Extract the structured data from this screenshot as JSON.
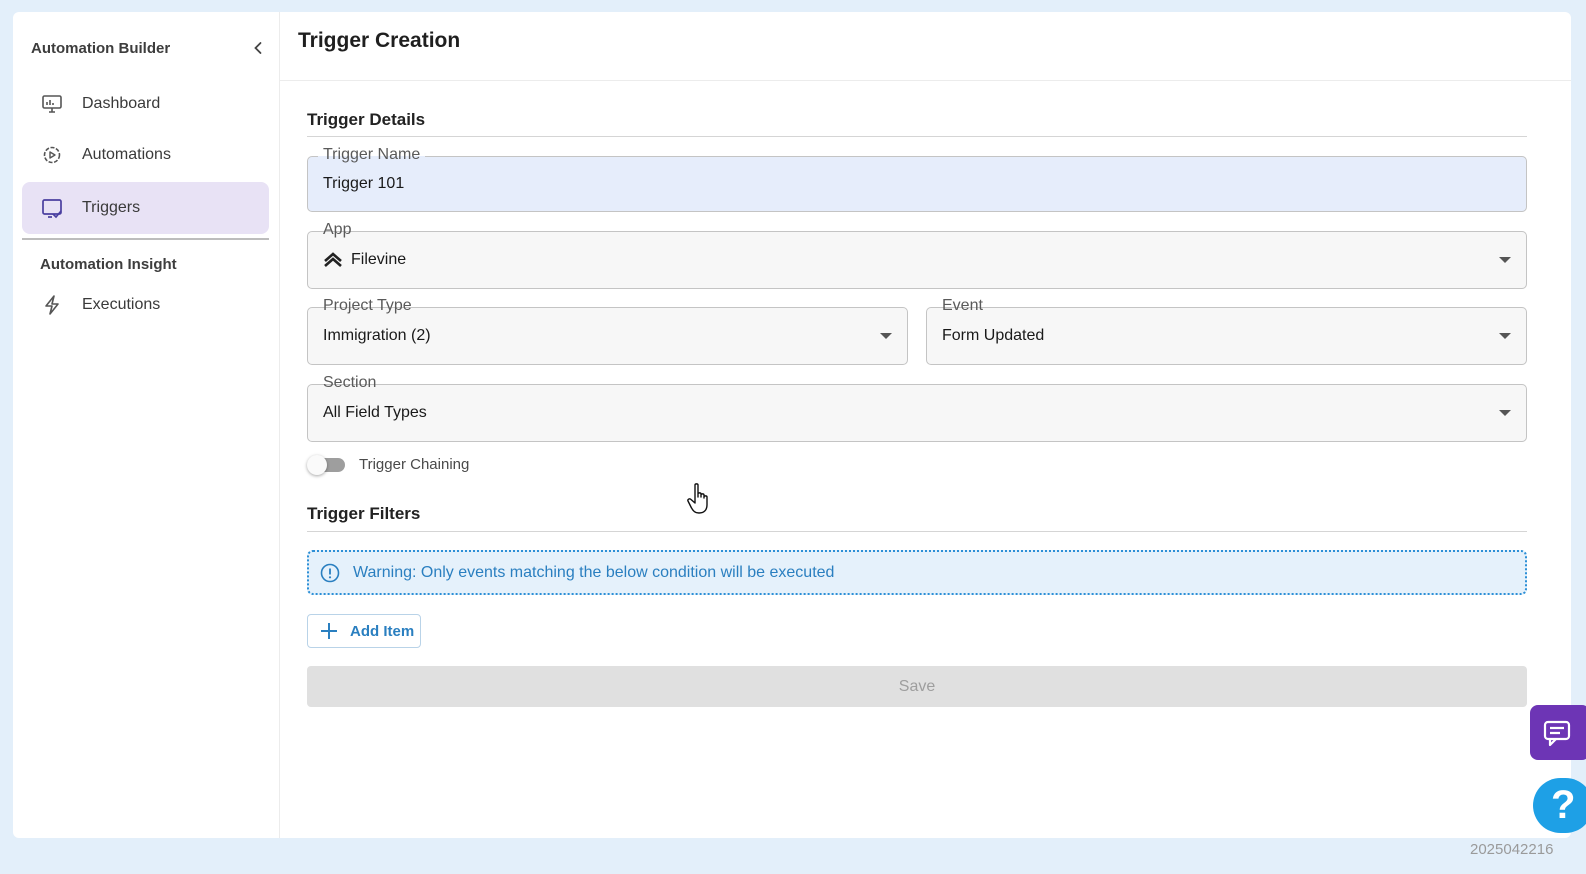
{
  "sidebar": {
    "title": "Automation Builder",
    "items": [
      {
        "label": "Dashboard",
        "icon": "monitor-icon"
      },
      {
        "label": "Automations",
        "icon": "gear-play-icon"
      },
      {
        "label": "Triggers",
        "icon": "screen-check-icon",
        "active": true
      }
    ],
    "section_title": "Automation Insight",
    "section_items": [
      {
        "label": "Executions",
        "icon": "lightning-icon"
      }
    ]
  },
  "page": {
    "title": "Trigger Creation"
  },
  "trigger_details": {
    "title": "Trigger Details",
    "trigger_name": {
      "label": "Trigger Name",
      "value": "Trigger 101"
    },
    "app": {
      "label": "App",
      "value": "Filevine"
    },
    "project_type": {
      "label": "Project Type",
      "value": "Immigration (2)"
    },
    "event": {
      "label": "Event",
      "value": "Form Updated"
    },
    "section": {
      "label": "Section",
      "value": "All Field Types"
    },
    "trigger_chaining": {
      "label": "Trigger Chaining",
      "enabled": false
    }
  },
  "trigger_filters": {
    "title": "Trigger Filters",
    "warning": "Warning: Only events matching the below condition will be executed",
    "add_label": "Add Item"
  },
  "save_label": "Save",
  "help_label": "?",
  "build_id": "2025042216",
  "colors": {
    "accent": "#2a7fc0",
    "active_nav": "#e8e2f5",
    "chat": "#6d35b5",
    "help": "#1ea0e6"
  }
}
